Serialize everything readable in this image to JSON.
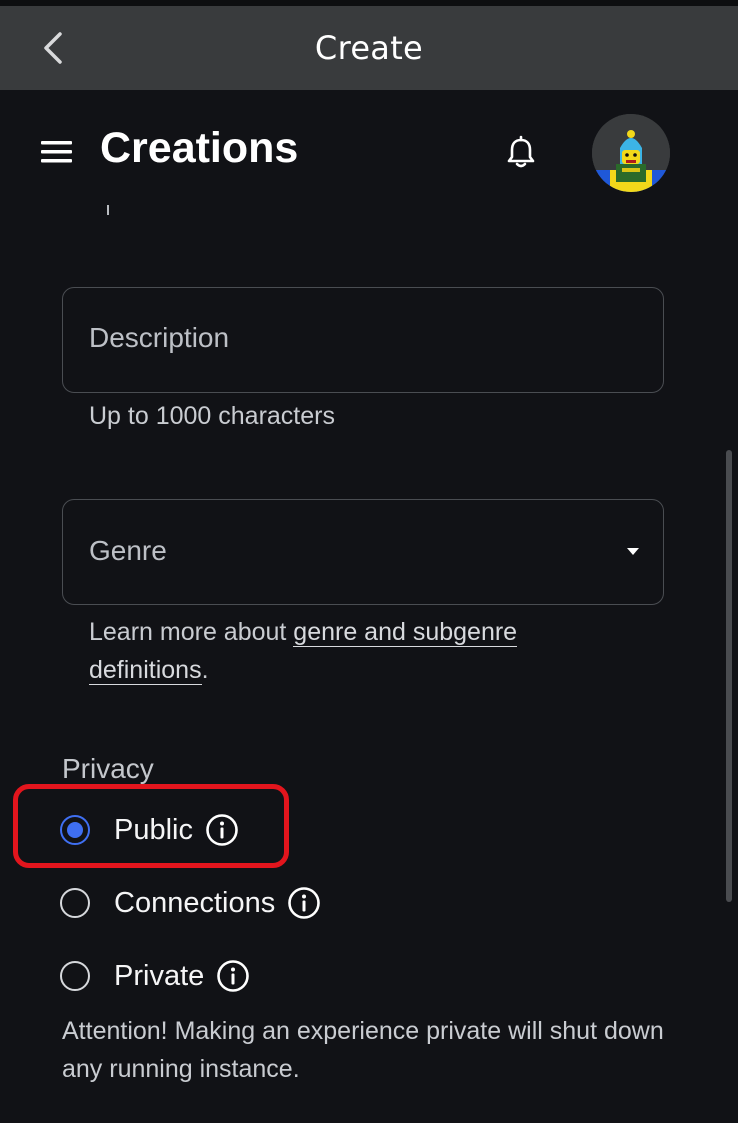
{
  "appbar": {
    "title": "Create"
  },
  "header": {
    "title": "Creations"
  },
  "form": {
    "description": {
      "placeholder": "Description",
      "helper": "Up to 1000 characters"
    },
    "genre": {
      "placeholder": "Genre",
      "learn_prefix": "Learn more about ",
      "learn_link": "genre and subgenre definitions",
      "learn_suffix": "."
    },
    "privacy": {
      "label": "Privacy",
      "options": [
        {
          "label": "Public",
          "selected": true
        },
        {
          "label": "Connections",
          "selected": false
        },
        {
          "label": "Private",
          "selected": false
        }
      ],
      "attention": "Attention! Making an experience private will shut down any running instance."
    }
  },
  "colors": {
    "accent": "#3f6ff2",
    "highlight": "#e3151d",
    "background": "#111216",
    "appbar": "#393b3d"
  },
  "icons": [
    "back-chevron-icon",
    "hamburger-menu-icon",
    "bell-icon",
    "info-icon",
    "dropdown-arrow-icon"
  ]
}
